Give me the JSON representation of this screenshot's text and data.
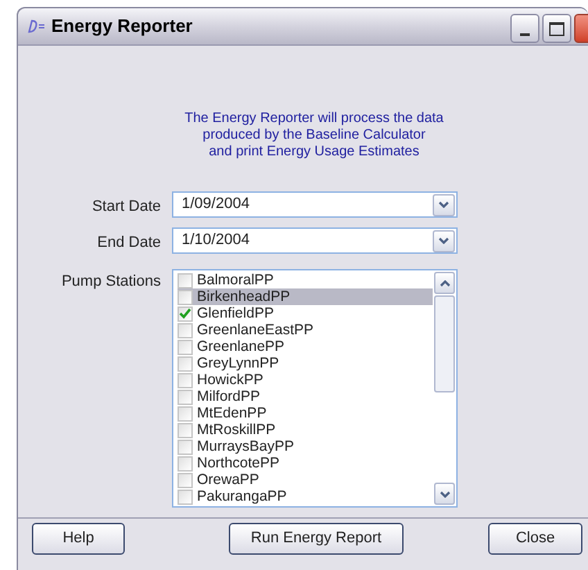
{
  "window": {
    "title": "Energy Reporter"
  },
  "description": [
    "The Energy Reporter will process the data",
    "produced by the Baseline Calculator",
    "and print Energy Usage Estimates"
  ],
  "start_date": {
    "label": "Start Date",
    "value": "1/09/2004"
  },
  "end_date": {
    "label": "End Date",
    "value": "1/10/2004"
  },
  "pump_stations": {
    "label": "Pump Stations",
    "items": [
      {
        "name": "BalmoralPP",
        "checked": false,
        "selected": false
      },
      {
        "name": "BirkenheadPP",
        "checked": false,
        "selected": true
      },
      {
        "name": "GlenfieldPP",
        "checked": true,
        "selected": false
      },
      {
        "name": "GreenlaneEastPP",
        "checked": false,
        "selected": false
      },
      {
        "name": "GreenlanePP",
        "checked": false,
        "selected": false
      },
      {
        "name": "GreyLynnPP",
        "checked": false,
        "selected": false
      },
      {
        "name": "HowickPP",
        "checked": false,
        "selected": false
      },
      {
        "name": "MilfordPP",
        "checked": false,
        "selected": false
      },
      {
        "name": "MtEdenPP",
        "checked": false,
        "selected": false
      },
      {
        "name": "MtRoskillPP",
        "checked": false,
        "selected": false
      },
      {
        "name": "MurraysBayPP",
        "checked": false,
        "selected": false
      },
      {
        "name": "NorthcotePP",
        "checked": false,
        "selected": false
      },
      {
        "name": "OrewaPP",
        "checked": false,
        "selected": false
      },
      {
        "name": "PakurangaPP",
        "checked": false,
        "selected": false
      }
    ]
  },
  "buttons": [
    "Help",
    "Run Energy Report",
    "Close"
  ]
}
